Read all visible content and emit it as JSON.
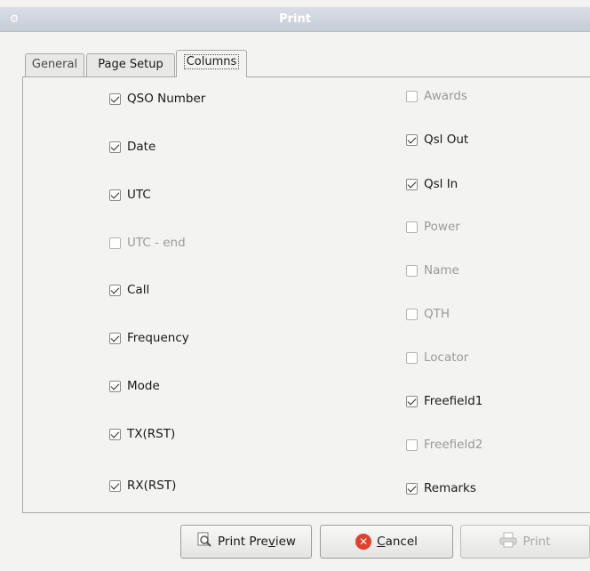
{
  "window": {
    "title": "Print",
    "icon": "app-icon"
  },
  "tabs": [
    {
      "label": "General",
      "active": false
    },
    {
      "label": "Page Setup",
      "active": false
    },
    {
      "label": "Columns",
      "active": true
    }
  ],
  "columns_left": [
    {
      "label": "QSO Number",
      "checked": true,
      "enabled": true
    },
    {
      "label": "Date",
      "checked": true,
      "enabled": true
    },
    {
      "label": "UTC",
      "checked": true,
      "enabled": true
    },
    {
      "label": "UTC - end",
      "checked": false,
      "enabled": false
    },
    {
      "label": "Call",
      "checked": true,
      "enabled": true
    },
    {
      "label": "Frequency",
      "checked": true,
      "enabled": true
    },
    {
      "label": "Mode",
      "checked": true,
      "enabled": true
    },
    {
      "label": "TX(RST)",
      "checked": true,
      "enabled": true
    },
    {
      "label": "RX(RST)",
      "checked": true,
      "enabled": true
    }
  ],
  "columns_right": [
    {
      "label": "Awards",
      "checked": false,
      "enabled": false
    },
    {
      "label": "Qsl Out",
      "checked": true,
      "enabled": true
    },
    {
      "label": "Qsl In",
      "checked": true,
      "enabled": true
    },
    {
      "label": "Power",
      "checked": false,
      "enabled": false
    },
    {
      "label": "Name",
      "checked": false,
      "enabled": false
    },
    {
      "label": "QTH",
      "checked": false,
      "enabled": false
    },
    {
      "label": "Locator",
      "checked": false,
      "enabled": false
    },
    {
      "label": "Freefield1",
      "checked": true,
      "enabled": true
    },
    {
      "label": "Freefield2",
      "checked": false,
      "enabled": false
    },
    {
      "label": "Remarks",
      "checked": true,
      "enabled": true
    }
  ],
  "buttons": {
    "preview_pre": "Print Pre",
    "preview_u": "v",
    "preview_post": "iew",
    "cancel_u": "C",
    "cancel_post": "ancel",
    "print": "Print",
    "print_enabled": false,
    "preview_icon": "magnifier-icon",
    "cancel_icon": "cancel-icon",
    "print_icon": "printer-icon"
  }
}
